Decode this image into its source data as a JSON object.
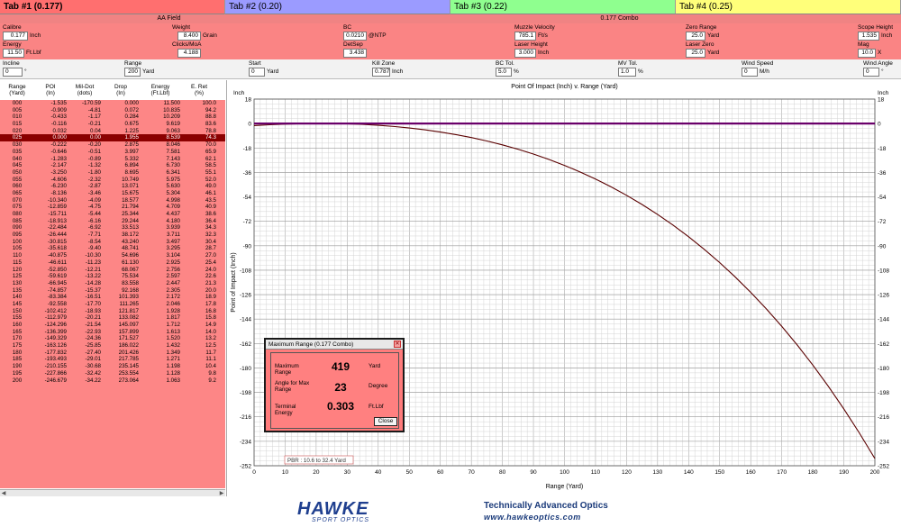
{
  "tabs": [
    {
      "label": "Tab #1 (0.177)"
    },
    {
      "label": "Tab #2 (0.20)"
    },
    {
      "label": "Tab #3 (0.22)"
    },
    {
      "label": "Tab #4 (0.25)"
    }
  ],
  "field_name": "AA Field",
  "combo_name": "0.177 Combo",
  "params": {
    "calibre": {
      "label": "Calibre",
      "value": "0.177",
      "unit": "Inch"
    },
    "energy": {
      "label": "Energy",
      "value": "11.50",
      "unit": "Ft.Lbf"
    },
    "weight": {
      "label": "Weight",
      "value": "8.400",
      "unit": "Grain"
    },
    "clicks_moa": {
      "label": "Clicks/MoA",
      "value": "4.188"
    },
    "bc": {
      "label": "BC",
      "value": "0.0210",
      "unit": "@NTP"
    },
    "detsep": {
      "label": "DetSep",
      "value": "3.438"
    },
    "muzzle_velocity": {
      "label": "Muzzle Velocity",
      "value": "785.1",
      "unit": "Ft/s"
    },
    "laser_height": {
      "label": "Laser Height",
      "value": "3.000",
      "unit": "Inch"
    },
    "zero_range": {
      "label": "Zero Range",
      "value": "25.0",
      "unit": "Yard"
    },
    "laser_zero": {
      "label": "Laser Zero",
      "value": "25.0",
      "unit": "Yard"
    },
    "scope_height": {
      "label": "Scope Height",
      "value": "1.535",
      "unit": "Inch"
    },
    "mag": {
      "label": "Mag",
      "value": "10.0",
      "unit": "X"
    },
    "incline": {
      "label": "Incline",
      "value": "0",
      "unit": "°"
    },
    "range": {
      "label": "Range",
      "value": "200",
      "unit": "Yard"
    },
    "start": {
      "label": "Start",
      "value": "0",
      "unit": "Yard"
    },
    "kill_zone": {
      "label": "Kill Zone",
      "value": "0.787",
      "unit": "Inch"
    },
    "bc_tol": {
      "label": "BC Tol.",
      "value": "5.0",
      "unit": "%"
    },
    "mv_tol": {
      "label": "MV Tol.",
      "value": "1.0",
      "unit": "%"
    },
    "wind_speed": {
      "label": "Wind Speed",
      "value": "0",
      "unit": "M/h"
    },
    "wind_angle": {
      "label": "Wind Angle",
      "value": "0",
      "unit": "°"
    }
  },
  "table": {
    "headers": [
      [
        "Range",
        "(Yard)"
      ],
      [
        "POI",
        "(In)"
      ],
      [
        "Mil-Dot",
        "(dots)"
      ],
      [
        "Drop",
        "(In)"
      ],
      [
        "Energy",
        "(Ft.Lbf)"
      ],
      [
        "E. Ret",
        "(%)"
      ]
    ],
    "selected_row": "025",
    "rows": [
      [
        "000",
        "-1.535",
        "-170.59",
        "0.000",
        "11.500",
        "100.0"
      ],
      [
        "005",
        "-0.909",
        "-4.81",
        "0.072",
        "10.835",
        "94.2"
      ],
      [
        "010",
        "-0.433",
        "-1.17",
        "0.284",
        "10.209",
        "88.8"
      ],
      [
        "015",
        "-0.116",
        "-0.21",
        "0.675",
        "9.619",
        "83.6"
      ],
      [
        "020",
        "0.032",
        "0.04",
        "1.225",
        "9.063",
        "78.8"
      ],
      [
        "025",
        "0.000",
        "0.00",
        "1.955",
        "8.539",
        "74.3"
      ],
      [
        "030",
        "-0.222",
        "-0.20",
        "2.875",
        "8.046",
        "70.0"
      ],
      [
        "035",
        "-0.646",
        "-0.51",
        "3.997",
        "7.581",
        "65.9"
      ],
      [
        "040",
        "-1.283",
        "-0.89",
        "5.332",
        "7.143",
        "62.1"
      ],
      [
        "045",
        "-2.147",
        "-1.32",
        "6.894",
        "6.730",
        "58.5"
      ],
      [
        "050",
        "-3.250",
        "-1.80",
        "8.695",
        "6.341",
        "55.1"
      ],
      [
        "055",
        "-4.606",
        "-2.32",
        "10.749",
        "5.975",
        "52.0"
      ],
      [
        "060",
        "-6.230",
        "-2.87",
        "13.071",
        "5.630",
        "49.0"
      ],
      [
        "065",
        "-8.136",
        "-3.46",
        "15.675",
        "5.304",
        "46.1"
      ],
      [
        "070",
        "-10.340",
        "-4.09",
        "18.577",
        "4.998",
        "43.5"
      ],
      [
        "075",
        "-12.859",
        "-4.75",
        "21.794",
        "4.709",
        "40.9"
      ],
      [
        "080",
        "-15.711",
        "-5.44",
        "25.344",
        "4.437",
        "38.6"
      ],
      [
        "085",
        "-18.913",
        "-6.16",
        "29.244",
        "4.180",
        "36.4"
      ],
      [
        "090",
        "-22.484",
        "-6.92",
        "33.513",
        "3.939",
        "34.3"
      ],
      [
        "095",
        "-26.444",
        "-7.71",
        "38.172",
        "3.711",
        "32.3"
      ],
      [
        "100",
        "-30.815",
        "-8.54",
        "43.240",
        "3.497",
        "30.4"
      ],
      [
        "105",
        "-35.618",
        "-9.40",
        "48.741",
        "3.295",
        "28.7"
      ],
      [
        "110",
        "-40.875",
        "-10.30",
        "54.696",
        "3.104",
        "27.0"
      ],
      [
        "115",
        "-46.611",
        "-11.23",
        "61.130",
        "2.925",
        "25.4"
      ],
      [
        "120",
        "-52.850",
        "-12.21",
        "68.067",
        "2.756",
        "24.0"
      ],
      [
        "125",
        "-59.619",
        "-13.22",
        "75.534",
        "2.597",
        "22.6"
      ],
      [
        "130",
        "-66.945",
        "-14.28",
        "83.558",
        "2.447",
        "21.3"
      ],
      [
        "135",
        "-74.857",
        "-15.37",
        "92.168",
        "2.305",
        "20.0"
      ],
      [
        "140",
        "-83.384",
        "-16.51",
        "101.393",
        "2.172",
        "18.9"
      ],
      [
        "145",
        "-92.558",
        "-17.70",
        "111.265",
        "2.046",
        "17.8"
      ],
      [
        "150",
        "-102.412",
        "-18.93",
        "121.817",
        "1.928",
        "16.8"
      ],
      [
        "155",
        "-112.979",
        "-20.21",
        "133.082",
        "1.817",
        "15.8"
      ],
      [
        "160",
        "-124.296",
        "-21.54",
        "145.097",
        "1.712",
        "14.9"
      ],
      [
        "165",
        "-136.399",
        "-22.93",
        "157.899",
        "1.613",
        "14.0"
      ],
      [
        "170",
        "-149.329",
        "-24.36",
        "171.527",
        "1.520",
        "13.2"
      ],
      [
        "175",
        "-163.126",
        "-25.85",
        "186.022",
        "1.432",
        "12.5"
      ],
      [
        "180",
        "-177.832",
        "-27.40",
        "201.426",
        "1.349",
        "11.7"
      ],
      [
        "185",
        "-193.493",
        "-29.01",
        "217.785",
        "1.271",
        "11.1"
      ],
      [
        "190",
        "-210.155",
        "-30.68",
        "235.145",
        "1.198",
        "10.4"
      ],
      [
        "195",
        "-227.866",
        "-32.42",
        "253.554",
        "1.128",
        "9.8"
      ],
      [
        "200",
        "-246.679",
        "-34.22",
        "273.064",
        "1.063",
        "9.2"
      ]
    ]
  },
  "chart_data": {
    "type": "line",
    "title": "Point Of Impact (Inch) v. Range (Yard)",
    "xlabel": "Range (Yard)",
    "ylabel": "Point of Impact (Inch)",
    "unit_label": "Inch",
    "xlim": [
      0,
      200
    ],
    "ylim": [
      -252,
      18
    ],
    "x_ticks": [
      0,
      10,
      20,
      30,
      40,
      50,
      60,
      70,
      80,
      90,
      100,
      110,
      120,
      130,
      140,
      150,
      160,
      170,
      180,
      190,
      200
    ],
    "y_ticks": [
      18,
      0,
      -18,
      -36,
      -54,
      -72,
      -90,
      -108,
      -126,
      -144,
      -162,
      -180,
      -198,
      -216,
      -234,
      -252
    ],
    "grid": true,
    "series": [
      {
        "color": "#5a0000",
        "x": [
          0,
          5,
          10,
          15,
          20,
          25,
          30,
          35,
          40,
          45,
          50,
          55,
          60,
          65,
          70,
          75,
          80,
          85,
          90,
          95,
          100,
          105,
          110,
          115,
          120,
          125,
          130,
          135,
          140,
          145,
          150,
          155,
          160,
          165,
          170,
          175,
          180,
          185,
          190,
          195,
          200
        ],
        "y": [
          -1.535,
          -0.909,
          -0.433,
          -0.116,
          0.032,
          0.0,
          -0.222,
          -0.646,
          -1.283,
          -2.147,
          -3.25,
          -4.606,
          -6.23,
          -8.136,
          -10.34,
          -12.859,
          -15.711,
          -18.913,
          -22.484,
          -26.444,
          -30.815,
          -35.618,
          -40.875,
          -46.611,
          -52.85,
          -59.619,
          -66.945,
          -74.857,
          -83.384,
          -92.558,
          -102.412,
          -112.979,
          -124.296,
          -136.399,
          -149.329,
          -163.126,
          -177.832,
          -193.493,
          -210.155,
          -227.866,
          -246.679
        ]
      },
      {
        "color": "#6a006a",
        "x": [
          0,
          200
        ],
        "y": [
          0,
          0
        ]
      }
    ],
    "pbr_label": "PBR : 10.6 to 32.4 Yard"
  },
  "dialog": {
    "title": "Maximum Range (0.177 Combo)",
    "close_glyph": "✕",
    "rows": [
      {
        "label": "Maximum Range",
        "value": "419",
        "unit": "Yard"
      },
      {
        "label": "Angle for Max Range",
        "value": "23",
        "unit": "Degree"
      },
      {
        "label": "Terminal Energy",
        "value": "0.303",
        "unit": "Ft.Lbf"
      }
    ],
    "close_label": "Close"
  },
  "footer": {
    "brand": "HAWKE",
    "brand_sub": "SPORT OPTICS",
    "tagline": "Technically Advanced Optics",
    "website": "www.hawkeoptics.com"
  },
  "colors": {
    "panel": "#fa8484",
    "selected_row": "#8b0000",
    "curve": "#5a0000",
    "zero_line": "#6a006a"
  }
}
